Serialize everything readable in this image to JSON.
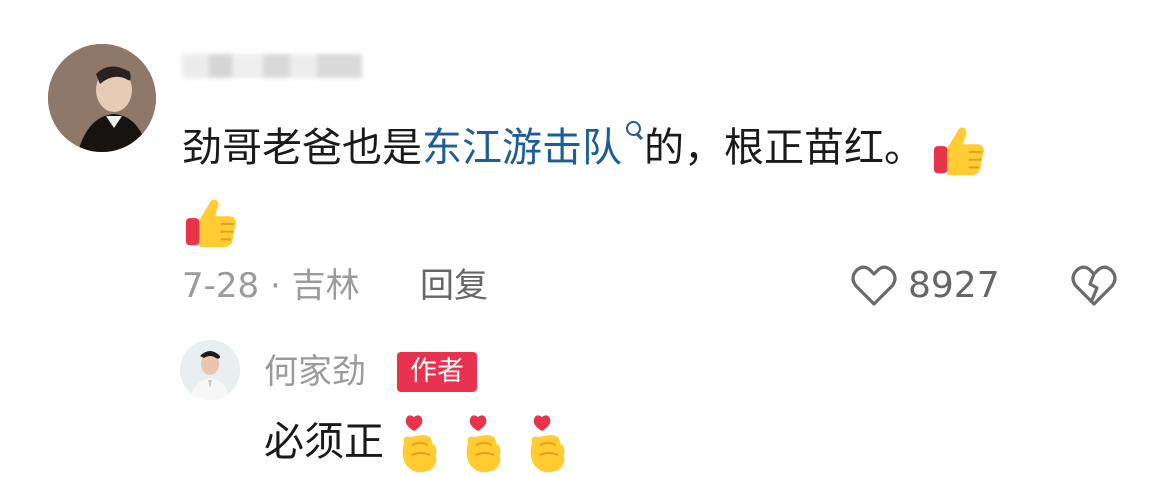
{
  "comment": {
    "text_before_link": "劲哥老爸也是",
    "link_text": "东江游击队",
    "text_after_link": "的，根正苗红。",
    "emojis": [
      "thumbs-up-icon",
      "thumbs-up-icon"
    ],
    "date_location": "7-28 · 吉林",
    "reply_label": "回复",
    "like_count": "8927"
  },
  "reply": {
    "username": "何家劲",
    "badge": "作者",
    "text": "必须正",
    "emojis": [
      "heart-hand-icon",
      "heart-hand-icon",
      "heart-hand-icon"
    ]
  },
  "colors": {
    "link": "#1f5d96",
    "badge_bg": "#e8324f",
    "meta_gray": "#9b9b9b"
  }
}
